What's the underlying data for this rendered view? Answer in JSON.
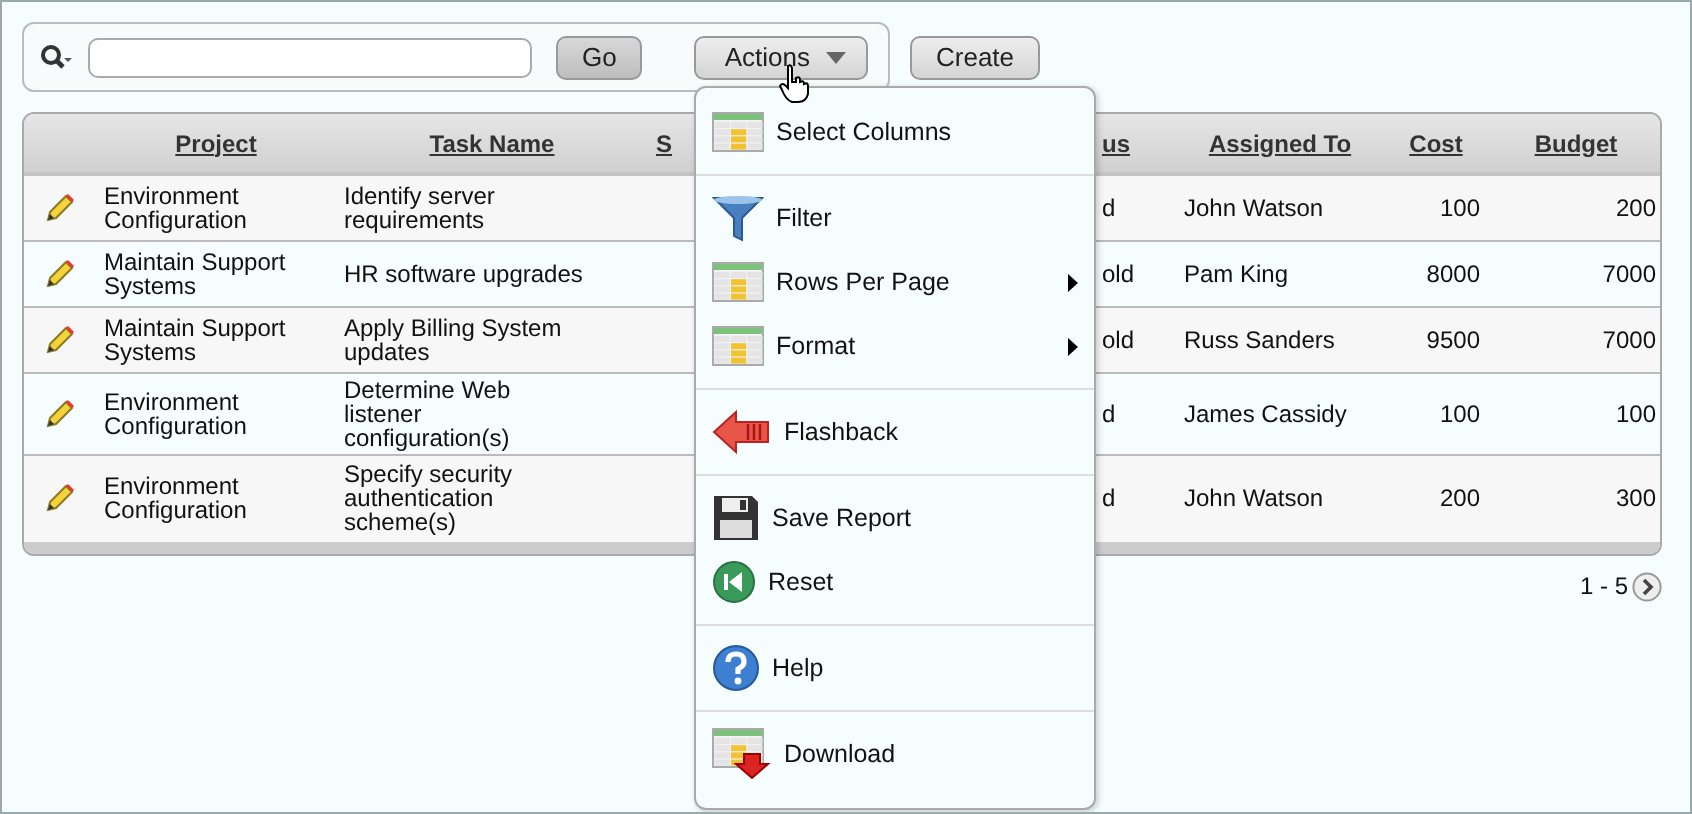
{
  "toolbar": {
    "buttons": [
      {
        "label": "Go",
        "kind": "go"
      },
      {
        "label": "Actions",
        "kind": "dropdown"
      }
    ],
    "create_button": "Create"
  },
  "table": {
    "columns": [
      "Project",
      "Task Name",
      "S",
      "us",
      "Assigned To",
      "Cost",
      "Budget"
    ],
    "rows": [
      {
        "project": "Environment Configuration",
        "task": "Identify server requirements",
        "column_4": "d",
        "assigned_to": "John Watson",
        "cost": "100",
        "budget": "200"
      },
      {
        "project": "Maintain Support Systems",
        "task": "HR software upgrades",
        "column_4": "old",
        "assigned_to": "Pam King",
        "cost": "8000",
        "budget": "7000"
      },
      {
        "project": "Maintain Support Systems",
        "task": "Apply Billing System updates",
        "column_4": "old",
        "assigned_to": "Russ Sanders",
        "cost": "9500",
        "budget": "7000"
      },
      {
        "project": "Environment Configuration",
        "task": "Determine Web listener configuration(s)",
        "column_4": "d",
        "assigned_to": "James Cassidy",
        "cost": "100",
        "budget": "100"
      },
      {
        "project": "Environment Configuration",
        "task": "Specify security authentication scheme(s)",
        "column_4": "d",
        "assigned_to": "John Watson",
        "cost": "200",
        "budget": "300"
      }
    ]
  },
  "pagination": {
    "range": "1 - 5"
  },
  "actions_menu": {
    "groups": [
      [
        {
          "label": "Select Columns",
          "kind": "columns",
          "has_submenu": false
        }
      ],
      [
        {
          "label": "Filter",
          "kind": "filter",
          "has_submenu": false
        },
        {
          "label": "Rows Per Page",
          "kind": "grid",
          "has_submenu": true
        },
        {
          "label": "Format",
          "kind": "grid",
          "has_submenu": true
        }
      ],
      [
        {
          "label": "Flashback",
          "kind": "flashback",
          "has_submenu": false
        }
      ],
      [
        {
          "label": "Save Report",
          "kind": "save",
          "has_submenu": false
        },
        {
          "label": "Reset",
          "kind": "reset",
          "has_submenu": false
        }
      ],
      [
        {
          "label": "Help",
          "kind": "help",
          "has_submenu": false
        }
      ],
      [
        {
          "label": "Download",
          "kind": "download",
          "has_submenu": false
        }
      ]
    ]
  }
}
